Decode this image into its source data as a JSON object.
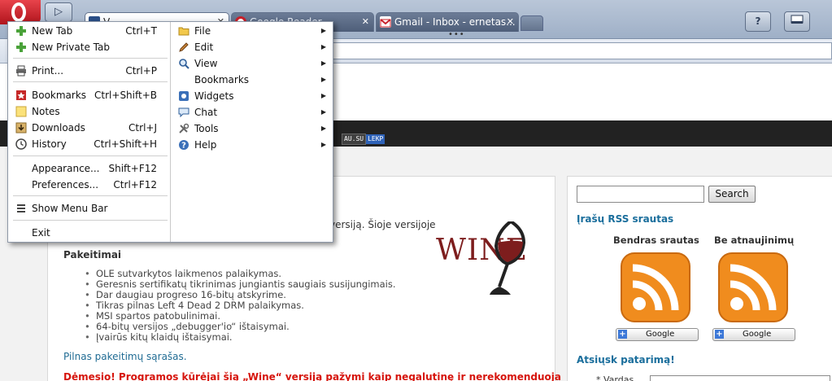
{
  "tabs": [
    {
      "title": "V..."
    },
    {
      "title": "Google Reader"
    },
    {
      "title": "Gmail - Inbox - ernetas..."
    }
  ],
  "tab_dots": "•••",
  "toolbar": {
    "help_label": "?"
  },
  "badges": [
    "AU.SU",
    "LEKP"
  ],
  "menu": {
    "left": [
      {
        "label": "New Tab",
        "shortcut": "Ctrl+T"
      },
      {
        "label": "New Private Tab",
        "shortcut": ""
      },
      {
        "label": "Print...",
        "shortcut": "Ctrl+P"
      },
      {
        "label": "Bookmarks",
        "shortcut": "Ctrl+Shift+B"
      },
      {
        "label": "Notes",
        "shortcut": ""
      },
      {
        "label": "Downloads",
        "shortcut": "Ctrl+J"
      },
      {
        "label": "History",
        "shortcut": "Ctrl+Shift+H"
      },
      {
        "label": "Appearance...",
        "shortcut": "Shift+F12"
      },
      {
        "label": "Preferences...",
        "shortcut": "Ctrl+F12"
      },
      {
        "label": "Show Menu Bar",
        "shortcut": ""
      },
      {
        "label": "Exit",
        "shortcut": ""
      }
    ],
    "right": [
      {
        "label": "File"
      },
      {
        "label": "Edit"
      },
      {
        "label": "View"
      },
      {
        "label": "Bookmarks"
      },
      {
        "label": "Widgets"
      },
      {
        "label": "Chat"
      },
      {
        "label": "Tools"
      },
      {
        "label": "Help"
      }
    ]
  },
  "article": {
    "intro_tail": "versiją. Šioje versijoje",
    "section_title": "Pakeitimai",
    "changes": [
      "OLE sutvarkytos laikmenos palaikymas.",
      "Geresnis sertifikatų tikrinimas jungiantis saugiais susijungimais.",
      "Dar daugiau progreso 16-bitų atskyrime.",
      "Tikras pilnas Left 4 Dead 2 DRM palaikymas.",
      "MSI spartos patobulinimai.",
      "64-bitų versijos „debugger'io“ ištaisymai.",
      "Įvairūs kitų klaidų ištaisymai."
    ],
    "full_list_link": "Pilnas pakeitimų sąrašas.",
    "warning": "Dėmesio! Programos kūrėjai šią „Wine“ versiją pažymi kaip negalutinę ir nerekomenduoja",
    "logo_text": "WINE"
  },
  "sidebar": {
    "search_button": "Search",
    "rss_heading": "Įrašų RSS srautas",
    "feeds": [
      {
        "label": "Bendras srautas",
        "button": "Google"
      },
      {
        "label": "Be atnaujinimų",
        "button": "Google"
      }
    ],
    "tip_heading": "Atsiųsk patarimą!",
    "tip_field_label": "* Vardas"
  },
  "colors": {
    "opera_red": "#c8202a",
    "link_blue": "#1a6e9c",
    "warning_red": "#d6140c",
    "wine_red": "#7d1d1d",
    "rss_orange": "#f08c1e"
  }
}
